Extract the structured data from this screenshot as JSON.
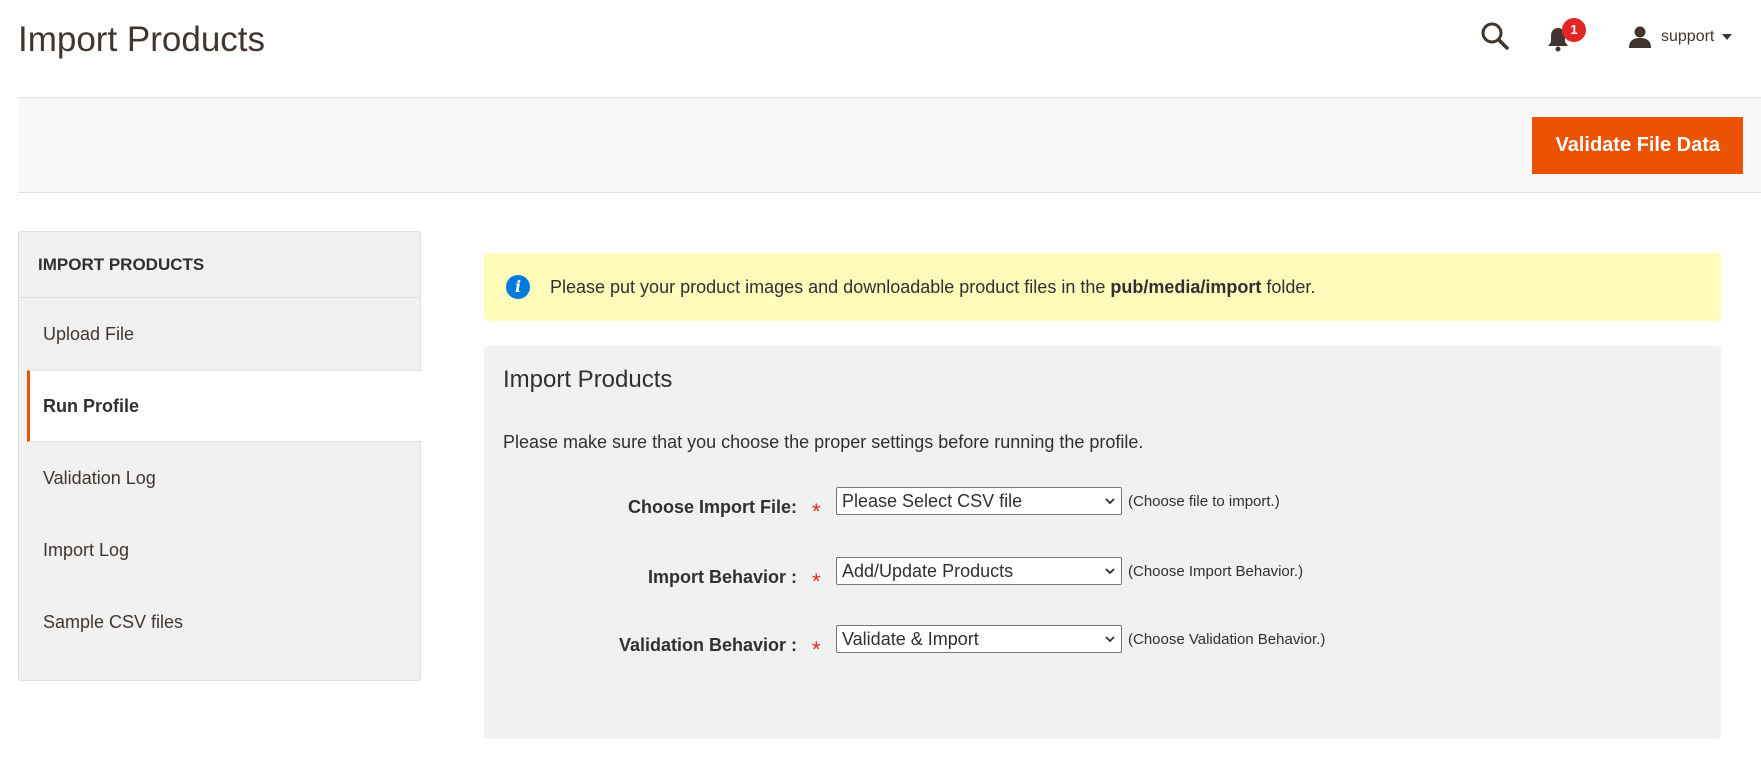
{
  "page": {
    "title": "Import Products"
  },
  "header": {
    "search_icon": "search-icon",
    "notifications": {
      "icon": "bell-icon",
      "count": "1"
    },
    "user": {
      "icon": "user-icon",
      "name": "support"
    }
  },
  "action_bar": {
    "validate_button": "Validate File Data"
  },
  "sidebar": {
    "title": "IMPORT PRODUCTS",
    "items": [
      {
        "label": "Upload File",
        "active": false
      },
      {
        "label": "Run Profile",
        "active": true
      },
      {
        "label": "Validation Log",
        "active": false
      },
      {
        "label": "Import Log",
        "active": false
      },
      {
        "label": "Sample CSV files",
        "active": false
      }
    ]
  },
  "notice": {
    "icon": "info-icon",
    "text_before": "Please put your product images and downloadable product files in the ",
    "path": "pub/media/import",
    "text_after": " folder."
  },
  "form": {
    "title": "Import Products",
    "note": "Please make sure that you choose the proper settings before running the profile.",
    "fields": [
      {
        "label": "Choose Import File:",
        "required": "*",
        "value": "Please Select CSV file",
        "hint": "(Choose file to import.)"
      },
      {
        "label": "Import Behavior :",
        "required": "*",
        "value": "Add/Update Products",
        "hint": "(Choose Import Behavior.)"
      },
      {
        "label": "Validation Behavior :",
        "required": "*",
        "value": "Validate & Import",
        "hint": "(Choose Validation Behavior.)"
      }
    ]
  },
  "colors": {
    "accent": "#eb5202",
    "badge": "#e22626",
    "notice_bg": "#fffbbb",
    "info": "#007bdb"
  }
}
